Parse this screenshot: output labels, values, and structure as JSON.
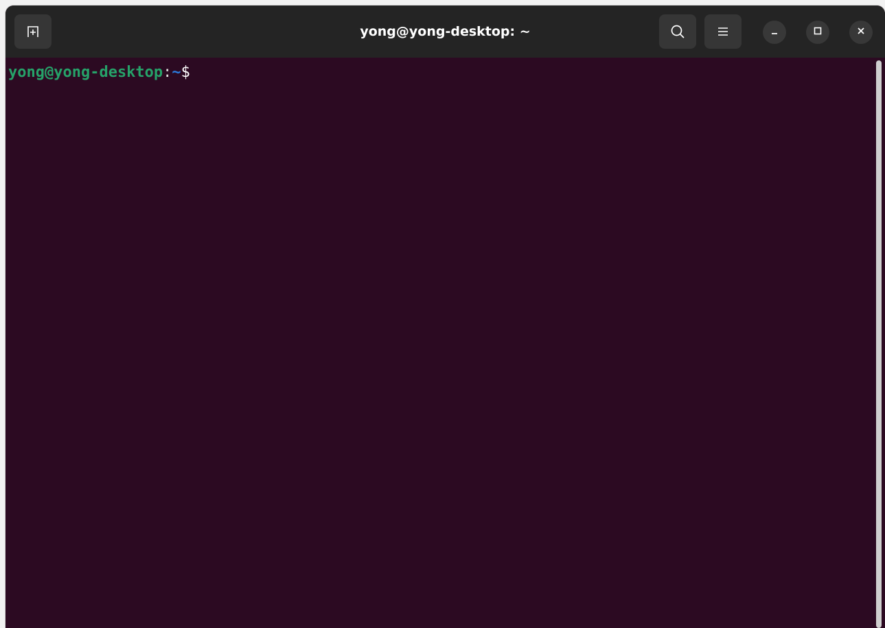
{
  "window": {
    "title": "yong@yong-desktop: ~"
  },
  "header": {
    "new_tab_icon": "new-tab-icon",
    "search_icon": "search-icon",
    "menu_icon": "hamburger-menu-icon",
    "minimize_icon": "minimize-icon",
    "maximize_icon": "maximize-icon",
    "close_icon": "close-icon"
  },
  "terminal": {
    "prompt_user_host": "yong@yong-desktop",
    "prompt_separator": ":",
    "prompt_path": "~",
    "prompt_symbol": "$"
  },
  "colors": {
    "terminal_background": "#2c0a22",
    "headerbar_background": "#242424",
    "prompt_user_color": "#26a269",
    "prompt_path_color": "#2a7bde",
    "text_color": "#ffffff"
  }
}
